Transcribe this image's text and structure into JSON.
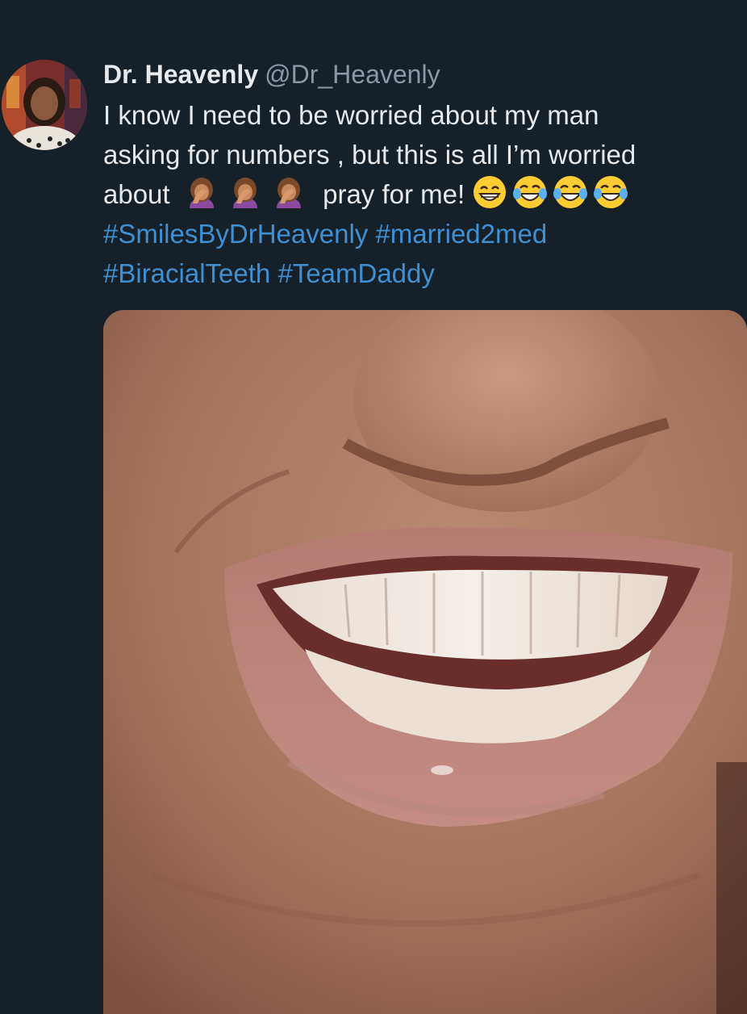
{
  "tweet": {
    "author": {
      "display_name": "Dr. Heavenly",
      "handle": "@Dr_Heavenly"
    },
    "text": {
      "line1": "I know I need to be worried about my man",
      "line2": "asking for numbers , but this is all I’m worried",
      "line3_start": "about",
      "line3_middle": "pray for me!"
    },
    "emojis": {
      "facepalm": [
        "woman-facepalming-emoji",
        "woman-facepalming-emoji",
        "woman-facepalming-emoji"
      ],
      "grinning": "grinning-face-with-smiling-eyes-emoji",
      "laughing": [
        "face-with-tears-of-joy-emoji",
        "face-with-tears-of-joy-emoji",
        "face-with-tears-of-joy-emoji"
      ]
    },
    "hashtags": [
      "#SmilesByDrHeavenly",
      "#married2med",
      "#BiracialTeeth",
      "#TeamDaddy"
    ]
  },
  "colors": {
    "background": "#152029",
    "text": "#e7e9ea",
    "handle": "#8b98a5",
    "hashtag": "#3f8fd3"
  }
}
